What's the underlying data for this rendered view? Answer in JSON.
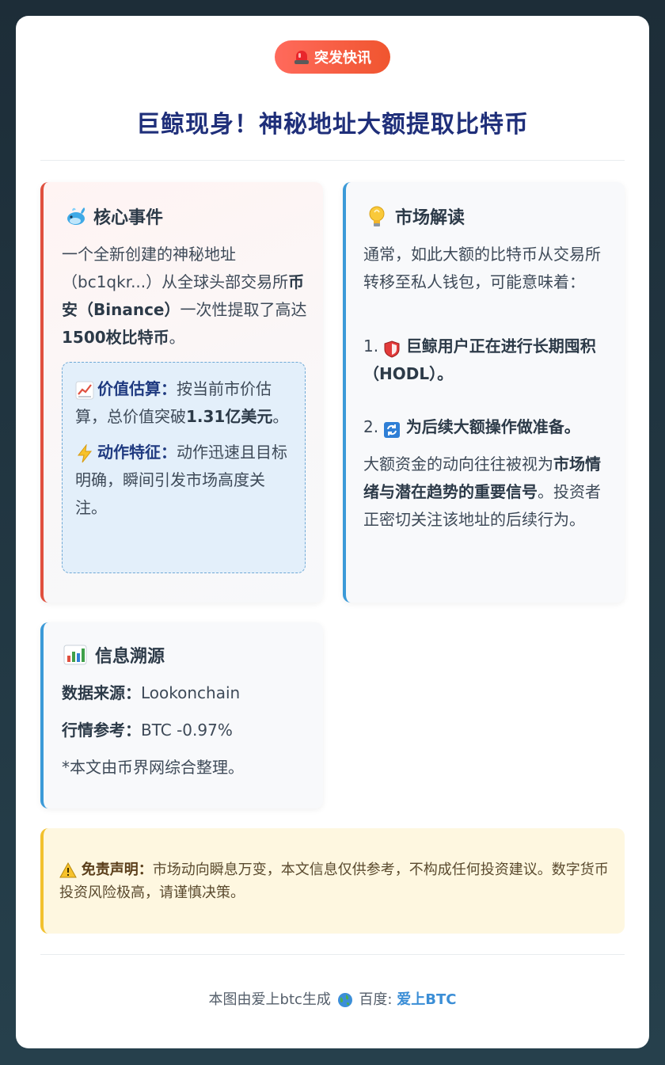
{
  "badge": {
    "label": "突发快讯"
  },
  "headline": "巨鲸现身！神秘地址大额提取比特币",
  "core": {
    "title": "核心事件",
    "p1": "一个全新创建的神秘地址（bc1qkr...）从全球头部交易所",
    "p1_bold": "币安（Binance）",
    "p1_rest": "一次性提取了高达",
    "p1_bold2": "1500枚比特币",
    "p1_end": "。",
    "value_label": "价值估算：",
    "value_text": "按当前市价估算，总价值突破",
    "value_bold": "1.31亿美元",
    "value_end": "。",
    "action_label": "动作特征：",
    "action_text": "动作迅速且目标明确，瞬间引发市场高度关注。"
  },
  "market": {
    "title": "市场解读",
    "intro": "通常，如此大额的比特币从交易所转移至私人钱包，可能意味着：",
    "item1_num": "1.",
    "item1": "巨鲸用户正在进行长期囤积（HODL）。",
    "item2_num": "2.",
    "item2": "为后续大额操作做准备。",
    "outro1": "大额资金的动向往往被视为",
    "outro_bold": "市场情绪与潜在趋势的重要信号",
    "outro2": "。投资者正密切关注该地址的后续行为。"
  },
  "source": {
    "title": "信息溯源",
    "data_label": "数据来源：",
    "data_value": "Lookonchain",
    "ref_label": "行情参考：",
    "ref_value": "BTC -0.97%",
    "note": "*本文由币界网综合整理。"
  },
  "disclaimer": {
    "label": "免责声明：",
    "text": "市场动向瞬息万变，本文信息仅供参考，不构成任何投资建议。数字货币投资风险极高，请谨慎决策。"
  },
  "footer": {
    "text": "本图由爱上btc生成",
    "search_label": "百度:",
    "brand": "爱上BTC"
  },
  "colors": {
    "accent_red": "#e0503f",
    "accent_blue": "#3b9ad8",
    "accent_yellow": "#f2c12e",
    "title": "#1f2f7a"
  }
}
